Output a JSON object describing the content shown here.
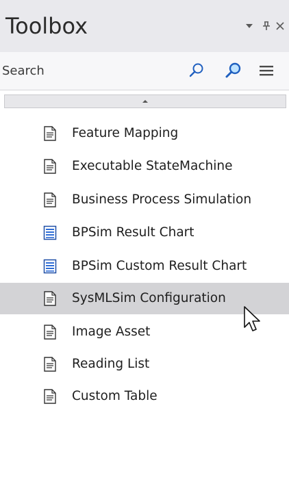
{
  "window": {
    "title": "Toolbox",
    "icons": {
      "dropdown": "chevron-down-icon",
      "pin": "pin-icon",
      "close": "close-icon"
    }
  },
  "search": {
    "placeholder": "Search",
    "value": "",
    "icons": {
      "search": "search-icon",
      "find": "find-icon",
      "menu": "menu-icon"
    }
  },
  "scroll": {
    "icon": "scroll-up-icon"
  },
  "items": [
    {
      "label": "Feature Mapping",
      "icon": "document-icon",
      "selected": false
    },
    {
      "label": "Executable StateMachine",
      "icon": "document-icon",
      "selected": false
    },
    {
      "label": "Business Process Simulation",
      "icon": "document-icon",
      "selected": false
    },
    {
      "label": "BPSim Result Chart",
      "icon": "chart-document-icon",
      "selected": false
    },
    {
      "label": "BPSim Custom Result Chart",
      "icon": "chart-document-icon",
      "selected": false
    },
    {
      "label": "SysMLSim Configuration",
      "icon": "document-icon",
      "selected": true
    },
    {
      "label": "Image Asset",
      "icon": "document-icon",
      "selected": false
    },
    {
      "label": "Reading List",
      "icon": "document-icon",
      "selected": false
    },
    {
      "label": "Custom Table",
      "icon": "document-icon",
      "selected": false
    }
  ],
  "colors": {
    "titlebar": "#e9e9ed",
    "selection": "#d3d3d6",
    "accent_blue": "#1f5fbf"
  }
}
